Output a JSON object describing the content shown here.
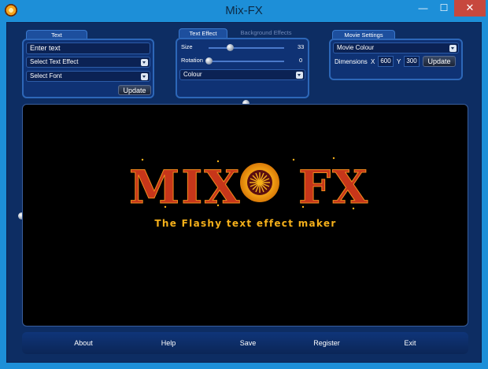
{
  "window": {
    "title": "Mix-FX",
    "min": "—",
    "max": "☐",
    "close": "✕"
  },
  "text_panel": {
    "tab": "Text",
    "input_value": "Enter text",
    "effect_select": "Select Text Effect",
    "font_select": "Select Font",
    "update": "Update"
  },
  "effect_panel": {
    "tab_active": "Text Effect",
    "tab_inactive": "Background Effects",
    "size_label": "Size",
    "size_value": "33",
    "size_level": 0.28,
    "rotation_label": "Rotation",
    "rotation_value": "0",
    "rotation_level": 0.0,
    "colour_select": "Colour"
  },
  "movie_panel": {
    "tab": "Movie Settings",
    "colour_select": "Movie Colour",
    "dimensions_label": "Dimensions",
    "x_label": "X",
    "x_value": "600",
    "y_label": "Y",
    "y_value": "300",
    "update": "Update"
  },
  "stage": {
    "logo_left": "MIX",
    "logo_right": "FX",
    "tagline": "The Flashy text effect maker"
  },
  "bottom_nav": [
    "About",
    "Help",
    "Save",
    "Register",
    "Exit"
  ],
  "colors": {
    "accent": "#1d8fd8",
    "panel": "#0f3274",
    "logo_red": "#c7361a",
    "logo_gold": "#f5b01a"
  }
}
